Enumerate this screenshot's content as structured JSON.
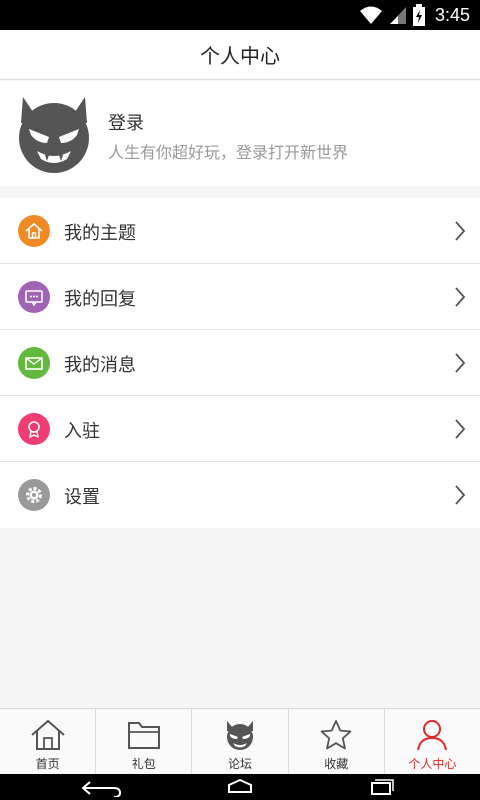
{
  "status_bar": {
    "time": "3:45"
  },
  "header": {
    "title": "个人中心"
  },
  "profile": {
    "login": "登录",
    "subtitle": "人生有你超好玩，登录打开新世界"
  },
  "menu": {
    "items": [
      {
        "label": "我的主题",
        "icon": "home-icon",
        "color": "#f08a24"
      },
      {
        "label": "我的回复",
        "icon": "message-icon",
        "color": "#a064b4"
      },
      {
        "label": "我的消息",
        "icon": "envelope-icon",
        "color": "#63b83e"
      },
      {
        "label": "入驻",
        "icon": "badge-icon",
        "color": "#ef3d72"
      },
      {
        "label": "设置",
        "icon": "gear-icon",
        "color": "#9a9a9a"
      }
    ]
  },
  "tabs": [
    {
      "label": "首页",
      "icon": "home-icon"
    },
    {
      "label": "礼包",
      "icon": "folder-icon"
    },
    {
      "label": "论坛",
      "icon": "devil-icon"
    },
    {
      "label": "收藏",
      "icon": "star-icon"
    },
    {
      "label": "个人中心",
      "icon": "person-icon",
      "active": true
    }
  ],
  "colors": {
    "active_tab": "#e02a2a",
    "avatar": "#555555"
  }
}
